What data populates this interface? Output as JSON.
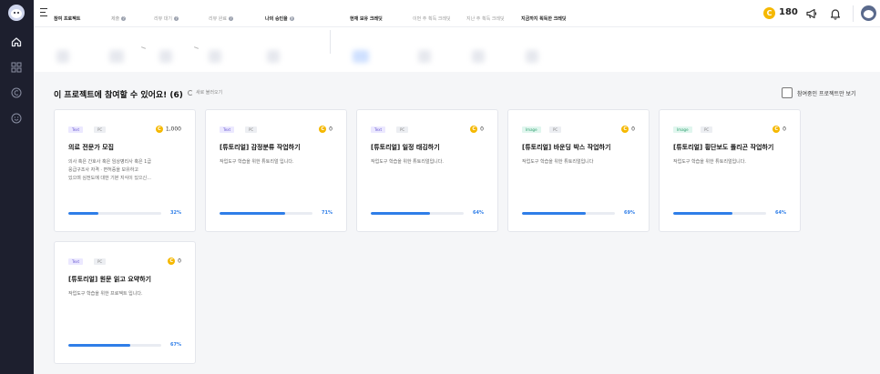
{
  "app": {
    "user_coins": "180"
  },
  "stats": {
    "labels": [
      "참여 프로젝트",
      "제출",
      "리뷰 대기",
      "리뷰 완료",
      "나의 승인율",
      "현재 보유 크레딧",
      "이번 주 획득 크레딧",
      "지난 주 획득 크레딧",
      "지금까지 획득한 크레딧"
    ]
  },
  "main": {
    "heading": "이 프로젝트에 참여할 수 있어요! (6)",
    "refresh_label": "새로 불러오기",
    "only_joined_label": "참여중인 프로젝트만 보기"
  },
  "projects": [
    {
      "type": "Text",
      "platform": "PC",
      "reward": "1,000",
      "title": "의료 전문가 모집",
      "desc_lines": [
        "의사 혹은 간호사 혹은 임상병리사 혹은 1급",
        "응급구조사 자격 · 면허증을 보유하고",
        "있으며 심전도에 대한 기본 지식이 있으신..."
      ],
      "progress": 32,
      "progress_label": "32%"
    },
    {
      "type": "Text",
      "platform": "PC",
      "reward": "0",
      "title": "[튜토리얼] 감정분류 작업하기",
      "desc_lines": [
        "작업도구 학습을 위한 튜토리얼 입니다."
      ],
      "progress": 71,
      "progress_label": "71%"
    },
    {
      "type": "Text",
      "platform": "PC",
      "reward": "0",
      "title": "[튜토리얼] 일정 태깅하기",
      "desc_lines": [
        "작업도구 학습을 위한 튜토리얼입니다."
      ],
      "progress": 64,
      "progress_label": "64%"
    },
    {
      "type": "Image",
      "platform": "PC",
      "reward": "0",
      "title": "[튜토리얼] 바운딩 박스 작업하기",
      "desc_lines": [
        "작업도구 학습을 위한 튜토리얼입니다"
      ],
      "progress": 69,
      "progress_label": "69%"
    },
    {
      "type": "Image",
      "platform": "PC",
      "reward": "0",
      "title": "[튜토리얼] 횡단보도 폴리곤 작업하기",
      "desc_lines": [
        "작업도구 학습을 위한 튜토리얼입니다."
      ],
      "progress": 64,
      "progress_label": "64%"
    },
    {
      "type": "Text",
      "platform": "PC",
      "reward": "0",
      "title": "[튜토리얼] 원문 읽고 요약하기",
      "desc_lines": [
        "작업도구 학습을 위한 프로젝트 입니다."
      ],
      "progress": 67,
      "progress_label": "67%"
    }
  ]
}
